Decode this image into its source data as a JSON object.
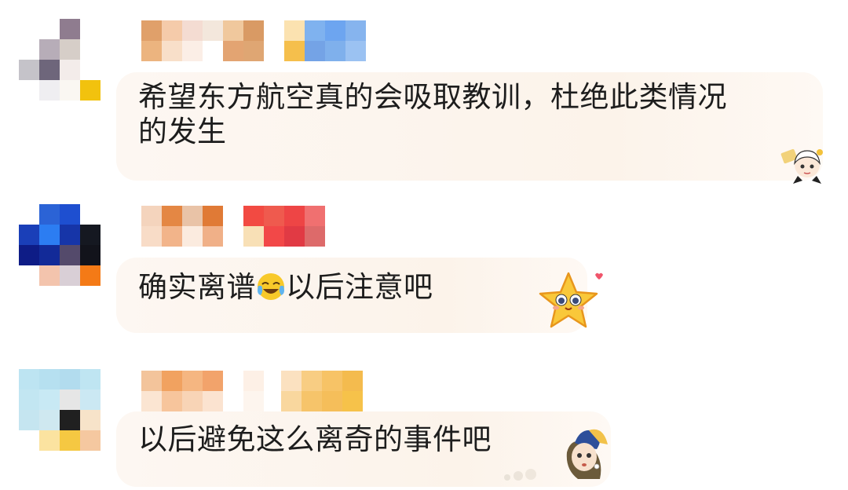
{
  "comments": [
    {
      "text": "希望东方航空真的会吸取教训，杜绝此类情况的发生",
      "text_line1": "希望东方航空真的会吸取教训，杜绝此类情况",
      "text_line2": "的发生",
      "sticker": "girl-sticker-icon"
    },
    {
      "text_before": "确实离谱",
      "emoji": "laughing-crying-emoji-icon",
      "text_after": "以后注意吧",
      "sticker": "star-sticker-icon"
    },
    {
      "text": "以后避免这么离奇的事件吧",
      "sticker": "pearl-earring-girl-sticker-icon"
    }
  ],
  "colors": {
    "text": "#1d1d1d",
    "bubble": "#fdf5ed"
  }
}
